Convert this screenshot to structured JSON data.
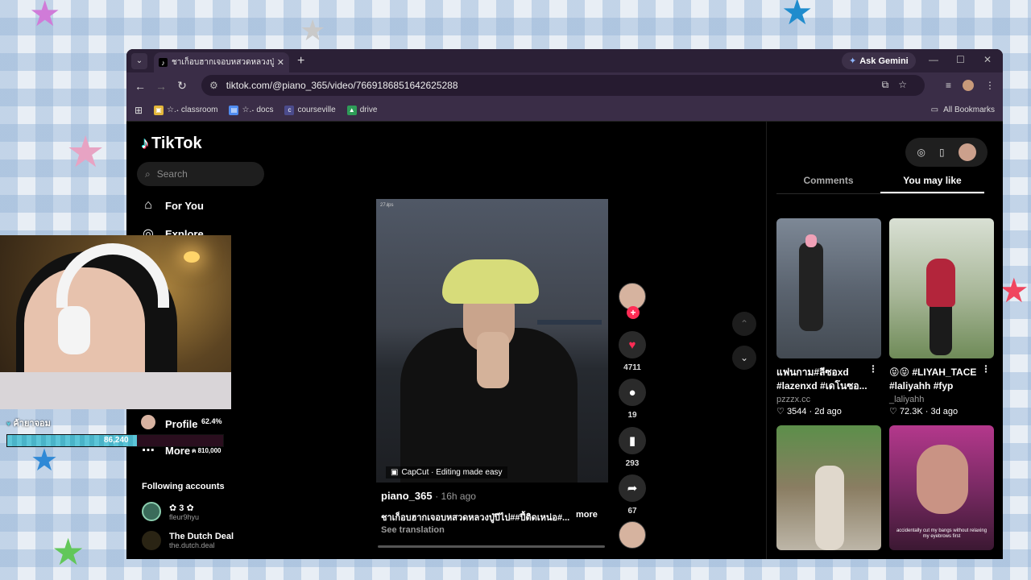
{
  "browser": {
    "tab_title": "ชาเก็อบฮากเจอบหสวดหลวงปู่ปีไป#สั",
    "ask_gemini": "Ask Gemini",
    "url": "tiktok.com/@piano_365/video/7669186851642625288",
    "bookmarks": [
      {
        "label": "☆.˖ classroom",
        "icon_color": "#e3b63a"
      },
      {
        "label": "☆.˖ docs",
        "icon_color": "#4f8cf0"
      },
      {
        "label": "courseville",
        "icon_color": "#4b4b8c"
      },
      {
        "label": "drive",
        "icon_color": "#2e9c58"
      }
    ],
    "all_bookmarks": "All Bookmarks"
  },
  "tiktok": {
    "logo_text": "TikTok",
    "search_placeholder": "Search",
    "nav": {
      "for_you": "For You",
      "explore": "Explore",
      "profile": "Profile",
      "more": "More"
    },
    "following_header": "Following accounts",
    "following": [
      {
        "name": "✿ 3 ✿",
        "handle": "fleur9hyu"
      },
      {
        "name": "The Dutch Deal",
        "handle": "the.dutch.deal"
      }
    ],
    "video": {
      "fps_label": "27Ⅎps",
      "capcut_label": "CapCut · Editing made easy",
      "username": "piano_365",
      "time_ago": "· 16h ago",
      "caption": "ชาเก็อบฮากเจอบหสวดหลวงปู่ปีไป##ปี้ติดเหน่อ#...",
      "more": "more",
      "see_translation": "See translation"
    },
    "actions": {
      "likes": "4711",
      "comments": "19",
      "saves": "293",
      "shares": "67"
    },
    "right_tabs": {
      "comments": "Comments",
      "you_may_like": "You may like"
    },
    "recommendations": [
      {
        "caption": "แฟนกาม#ลีซอxd #lazenxd #เดโนซอ...",
        "user": "pzzzx.cc",
        "likes": "3544",
        "age": "2d ago"
      },
      {
        "caption": "😝😝 #LIYAH_TACE #laliyahh #fyp",
        "user": "_laliyahh",
        "likes": "72.3K",
        "age": "3d ago"
      },
      {
        "caption": "",
        "user": "",
        "likes": "",
        "age": ""
      },
      {
        "caption": "accidentally cut my bangs without relaxing my eyebrows first",
        "user": "",
        "likes": "",
        "age": ""
      }
    ]
  },
  "overlay": {
    "player_name": "ค้ายาจอม",
    "hp_value": "86,240",
    "hp_fraction": 0.6,
    "profile_percent": "62.4%",
    "more_count": "ค 810,000"
  },
  "colors": {
    "accent_red": "#fe2c55",
    "hp_fill": "#5cc5d8",
    "browser_chrome": "#3a2d47"
  }
}
